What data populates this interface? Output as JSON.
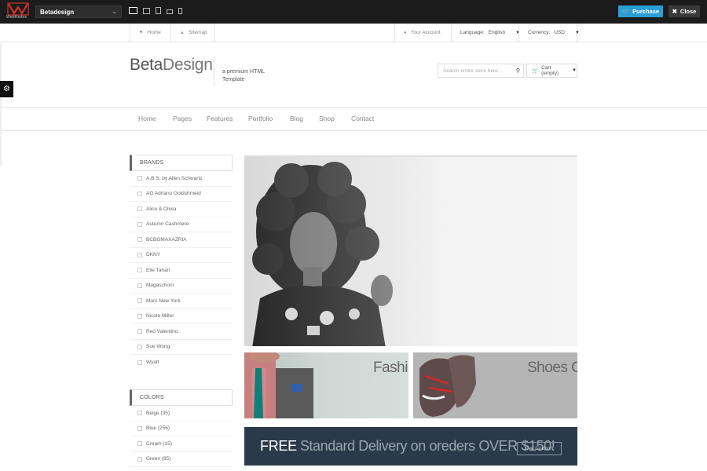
{
  "demobar": {
    "logo_text": "WebRedox",
    "theme_select": "Betadesign",
    "purchase_label": "Purchase",
    "close_label": "Close"
  },
  "toplinks": {
    "home": "Home",
    "sitemap": "Sitemap",
    "account": "Your Account",
    "language_label": "Language:",
    "language_value": "English",
    "currency_label": "Currency:",
    "currency_value": "USD"
  },
  "header": {
    "brand_bold": "Beta",
    "brand_light": "Design",
    "tagline": "a premium HTML Template",
    "search_placeholder": "Search entire store here...",
    "cart_label": "Cart (empty)"
  },
  "nav": [
    "Home",
    "Pages",
    "Features",
    "Portfolio",
    "Blog",
    "Shop",
    "Contact"
  ],
  "brands": {
    "title": "BRANDS",
    "items": [
      "A.B.S. by Allen Schwartz",
      "AG Adriano Goldshmeid",
      "Alice & Olivia",
      "Autumn Cashmere",
      "BCBGMAXAZRIA",
      "DKNY",
      "Elie Tahari",
      "Magaschoni",
      "Marc New York",
      "Nicole Miller",
      "Red Valentino",
      "Sue Wong",
      "Wyatt"
    ]
  },
  "colors": {
    "title": "COLORS",
    "items": [
      "Beige (35)",
      "Blue (256)",
      "Cream (15)",
      "Green (85)"
    ]
  },
  "banners": {
    "fashion": "Fashion",
    "shoes": "Shoes Col"
  },
  "delivery": {
    "free": "FREE",
    "rest": "Standard Delivery on oreders OVER $150!",
    "coupon": "Get Coupon"
  },
  "icons": {
    "home": "home-icon",
    "sitemap": "sitemap-icon",
    "account": "user-icon",
    "search": "search-icon",
    "cart": "cart-icon",
    "gear": "gear-icon"
  }
}
